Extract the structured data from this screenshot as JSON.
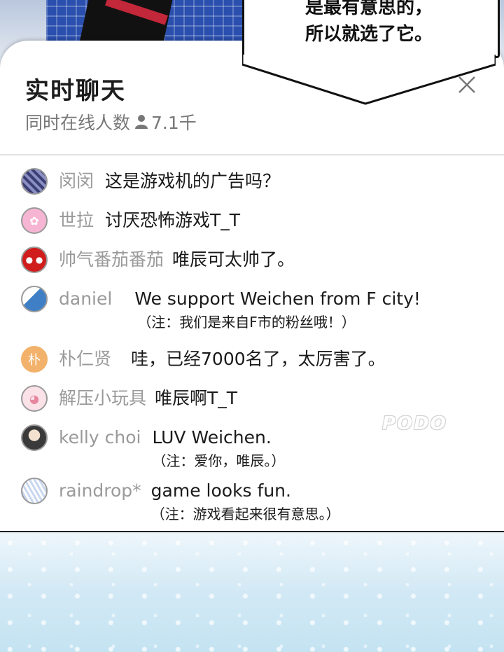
{
  "bubble": {
    "line1": "是最有意思的，",
    "line2": "所以就选了它。"
  },
  "chat": {
    "title": "实时聊天",
    "online_label": "同时在线人数",
    "online_count": "7.1千",
    "close_icon": "close-icon",
    "person_icon": "person-icon"
  },
  "messages": [
    {
      "user": "闵闵",
      "text": "这是游戏机的广告吗？",
      "note": "",
      "avatar_color": "#5a5f8a"
    },
    {
      "user": "世拉",
      "text": "讨厌恐怖游戏T_T",
      "note": "",
      "avatar_color": "#f2a6c8"
    },
    {
      "user": "帅气番茄番茄",
      "text": "唯辰可太帅了。",
      "note": "",
      "avatar_color": "#d11c1c"
    },
    {
      "user": "daniel",
      "text": "We support  Weichen from  F city!",
      "note": "（注：我们是来自F市的粉丝哦！）",
      "avatar_color": "#3f7fc6"
    },
    {
      "user": "朴仁贤",
      "text": "哇，已经7000名了，太厉害了。",
      "note": "",
      "avatar_color": "#f3b26b",
      "avatar_char": "朴"
    },
    {
      "user": "解压小玩具",
      "text": "唯辰啊T_T",
      "note": "",
      "avatar_color": "#f5c9d4"
    },
    {
      "user": "kelly choi",
      "text": "LUV  Weichen.",
      "note": "（注：爱你，唯辰。）",
      "avatar_color": "#6b6b6b"
    },
    {
      "user": "raindrop*",
      "text": "game looks fun.",
      "note": "（注：游戏看起来很有意思。）",
      "avatar_color": "#aec4e6"
    }
  ],
  "watermark": "PODO"
}
